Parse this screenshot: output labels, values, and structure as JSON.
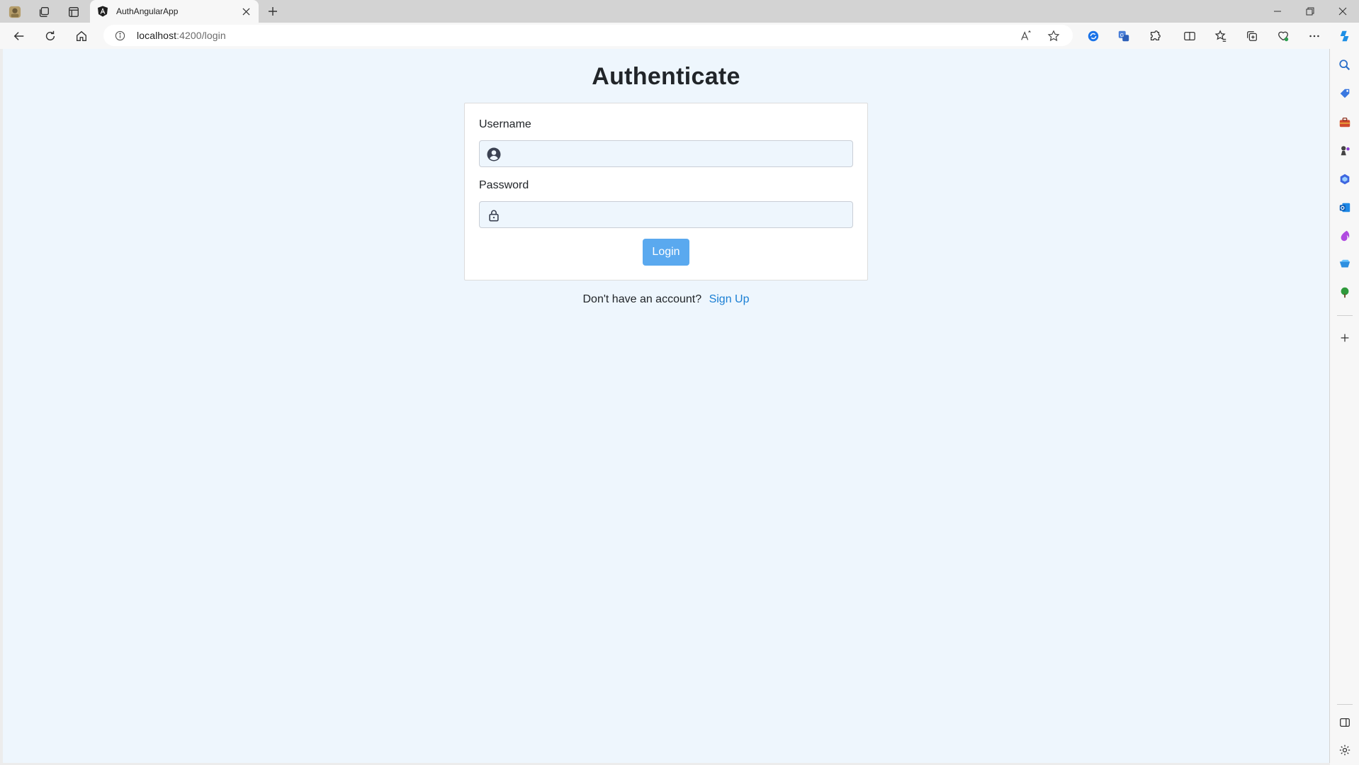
{
  "browser": {
    "tab": {
      "title": "AuthAngularApp",
      "favicon": "angular-logo-icon"
    },
    "address": {
      "host": "localhost",
      "path": ":4200/login"
    },
    "toolbar_icons": [
      "back-icon",
      "refresh-icon",
      "home-icon",
      "site-info-icon",
      "read-aloud-icon",
      "favorite-star-icon",
      "extension-icon",
      "translate-icon",
      "extensions-puzzle-icon",
      "split-screen-icon",
      "favorites-icon",
      "collections-icon",
      "browser-essentials-icon",
      "more-menu-icon",
      "copilot-icon"
    ],
    "sidebar_icons": [
      "search-icon",
      "shopping-tag-icon",
      "tools-briefcase-icon",
      "games-icon",
      "m365-icon",
      "outlook-icon",
      "drop-icon",
      "send-icon",
      "tree-icon",
      "add-icon",
      "sidebar-toggle-icon",
      "settings-icon"
    ]
  },
  "page": {
    "title": "Authenticate",
    "username": {
      "label": "Username",
      "value": "",
      "placeholder": ""
    },
    "password": {
      "label": "Password",
      "value": "",
      "placeholder": ""
    },
    "login_button": "Login",
    "signup_prompt": "Don't have an account?",
    "signup_link": "Sign Up"
  },
  "colors": {
    "page_background": "#eef6fd",
    "button": "#5aa9ef",
    "link": "#1a7fd4"
  }
}
